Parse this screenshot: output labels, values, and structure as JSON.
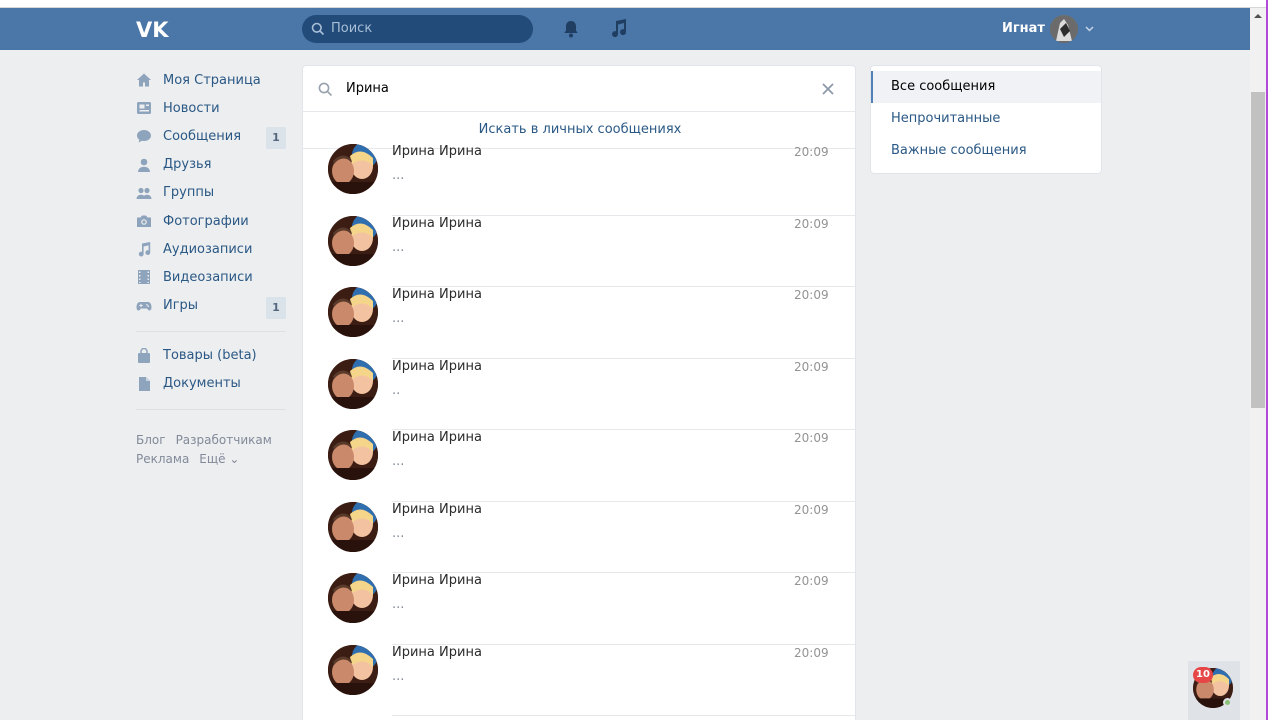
{
  "header": {
    "logo": "VK",
    "search_placeholder": "Поиск",
    "user_name": "Игнат",
    "icons": [
      "vk-logo-icon",
      "search-icon",
      "bell-icon",
      "music-note-icon",
      "chevron-down-icon"
    ]
  },
  "left_menu": {
    "items": [
      {
        "label": "Моя Страница",
        "icon": "home-icon",
        "count": ""
      },
      {
        "label": "Новости",
        "icon": "news-icon",
        "count": ""
      },
      {
        "label": "Сообщения",
        "icon": "chat-icon",
        "count": "1"
      },
      {
        "label": "Друзья",
        "icon": "person-icon",
        "count": ""
      },
      {
        "label": "Группы",
        "icon": "group-icon",
        "count": ""
      },
      {
        "label": "Фотографии",
        "icon": "camera-icon",
        "count": ""
      },
      {
        "label": "Аудиозаписи",
        "icon": "music-note-icon",
        "count": ""
      },
      {
        "label": "Видеозаписи",
        "icon": "film-icon",
        "count": ""
      },
      {
        "label": "Игры",
        "icon": "gamepad-icon",
        "count": "1"
      }
    ],
    "items2": [
      {
        "label": "Товары (beta)",
        "icon": "bag-icon"
      },
      {
        "label": "Документы",
        "icon": "document-icon"
      }
    ],
    "footer": [
      "Блог",
      "Разработчикам",
      "Реклама",
      "Ещё ⌄"
    ]
  },
  "search": {
    "query": "Ирина",
    "search_in_label": "Искать в личных сообщениях"
  },
  "conversations": [
    {
      "name": "Ирина Ирина",
      "time": "20:09",
      "preview": "..."
    },
    {
      "name": "Ирина Ирина",
      "time": "20:09",
      "preview": "..."
    },
    {
      "name": "Ирина Ирина",
      "time": "20:09",
      "preview": "..."
    },
    {
      "name": "Ирина Ирина",
      "time": "20:09",
      "preview": ".."
    },
    {
      "name": "Ирина Ирина",
      "time": "20:09",
      "preview": "..."
    },
    {
      "name": "Ирина Ирина",
      "time": "20:09",
      "preview": "..."
    },
    {
      "name": "Ирина Ирина",
      "time": "20:09",
      "preview": "..."
    },
    {
      "name": "Ирина Ирина",
      "time": "20:09",
      "preview": "..."
    }
  ],
  "filters": {
    "items": [
      "Все сообщения",
      "Непрочитанные",
      "Важные сообщения"
    ],
    "active": "Все сообщения"
  },
  "chat_bubble": {
    "count": "10"
  },
  "colors": {
    "header": "#4a76a8",
    "link": "#2a5885",
    "background": "#edeef0",
    "badge": "#e64646"
  }
}
